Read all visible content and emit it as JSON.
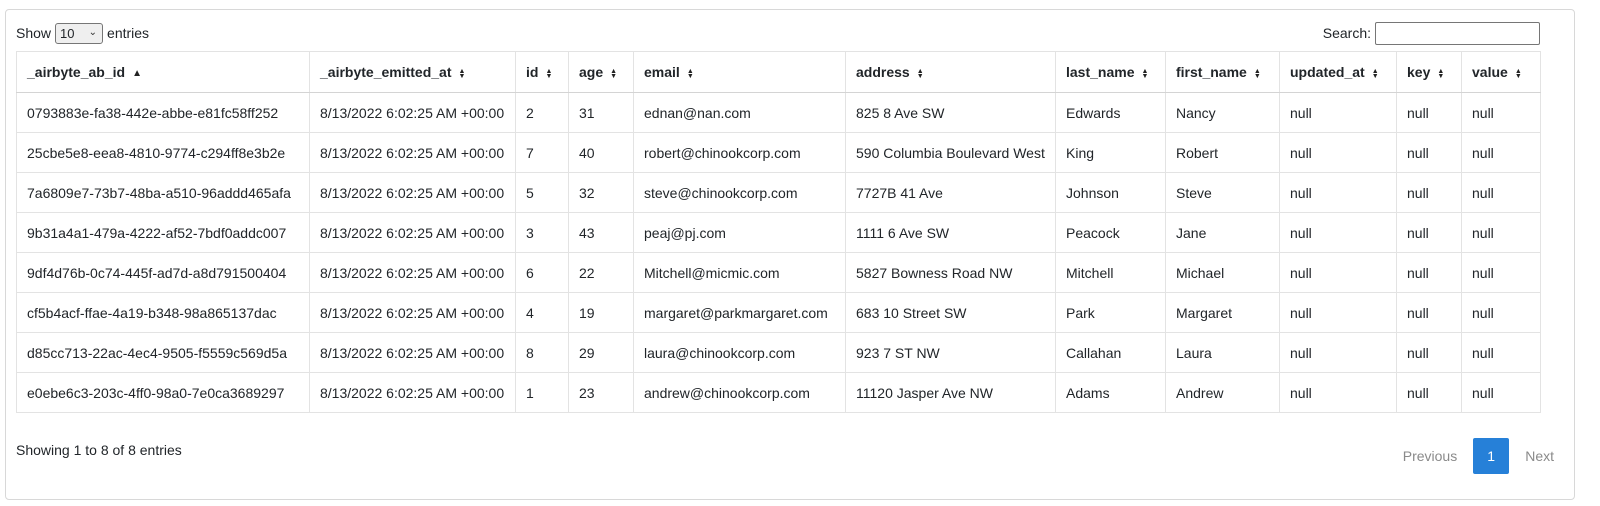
{
  "controls": {
    "show_label": "Show",
    "length_value": "10",
    "entries_label": "entries",
    "search_label": "Search:",
    "search_value": ""
  },
  "table": {
    "columns": [
      "_airbyte_ab_id",
      "_airbyte_emitted_at",
      "id",
      "age",
      "email",
      "address",
      "last_name",
      "first_name",
      "updated_at",
      "key",
      "value"
    ],
    "sorted_column": 0,
    "sort_direction": "asc",
    "rows": [
      [
        "0793883e-fa38-442e-abbe-e81fc58ff252",
        "8/13/2022 6:02:25 AM +00:00",
        "2",
        "31",
        "ednan@nan.com",
        "825 8 Ave SW",
        "Edwards",
        "Nancy",
        "null",
        "null",
        "null"
      ],
      [
        "25cbe5e8-eea8-4810-9774-c294ff8e3b2e",
        "8/13/2022 6:02:25 AM +00:00",
        "7",
        "40",
        "robert@chinookcorp.com",
        "590 Columbia Boulevard West",
        "King",
        "Robert",
        "null",
        "null",
        "null"
      ],
      [
        "7a6809e7-73b7-48ba-a510-96addd465afa",
        "8/13/2022 6:02:25 AM +00:00",
        "5",
        "32",
        "steve@chinookcorp.com",
        "7727B 41 Ave",
        "Johnson",
        "Steve",
        "null",
        "null",
        "null"
      ],
      [
        "9b31a4a1-479a-4222-af52-7bdf0addc007",
        "8/13/2022 6:02:25 AM +00:00",
        "3",
        "43",
        "peaj@pj.com",
        "1111 6 Ave SW",
        "Peacock",
        "Jane",
        "null",
        "null",
        "null"
      ],
      [
        "9df4d76b-0c74-445f-ad7d-a8d791500404",
        "8/13/2022 6:02:25 AM +00:00",
        "6",
        "22",
        "Mitchell@micmic.com",
        "5827 Bowness Road NW",
        "Mitchell",
        "Michael",
        "null",
        "null",
        "null"
      ],
      [
        "cf5b4acf-ffae-4a19-b348-98a865137dac",
        "8/13/2022 6:02:25 AM +00:00",
        "4",
        "19",
        "margaret@parkmargaret.com",
        "683 10 Street SW",
        "Park",
        "Margaret",
        "null",
        "null",
        "null"
      ],
      [
        "d85cc713-22ac-4ec4-9505-f5559c569d5a",
        "8/13/2022 6:02:25 AM +00:00",
        "8",
        "29",
        "laura@chinookcorp.com",
        "923 7 ST NW",
        "Callahan",
        "Laura",
        "null",
        "null",
        "null"
      ],
      [
        "e0ebe6c3-203c-4ff0-98a0-7e0ca3689297",
        "8/13/2022 6:02:25 AM +00:00",
        "1",
        "23",
        "andrew@chinookcorp.com",
        "11120 Jasper Ave NW",
        "Adams",
        "Andrew",
        "null",
        "null",
        "null"
      ]
    ]
  },
  "footer": {
    "info": "Showing 1 to 8 of 8 entries",
    "previous_label": "Previous",
    "current_page": "1",
    "next_label": "Next"
  },
  "icons": {
    "sort_asc": "sort-asc-icon",
    "sort_both": "sort-both-icon",
    "select_chevron": "chevron-down-icon"
  },
  "colors": {
    "accent": "#2680d8",
    "border": "#e3e3e3",
    "muted_text": "#8a8a8a"
  }
}
